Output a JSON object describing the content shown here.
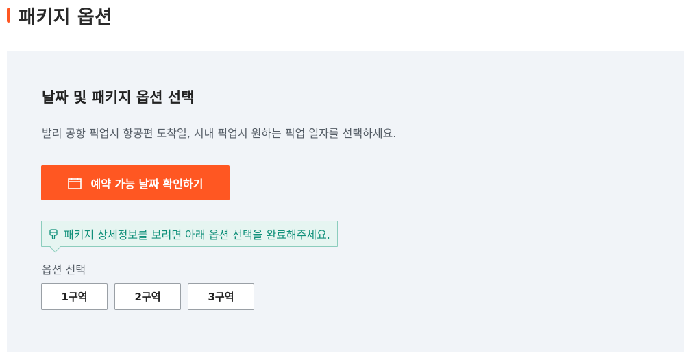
{
  "section": {
    "title": "패키지 옵션",
    "accent_color": "#ff5722"
  },
  "panel": {
    "title": "날짜 및 패키지 옵션 선택",
    "description": "발리 공항 픽업시 항공편 도착일, 시내 픽업시 원하는 픽업 일자를 선택하세요.",
    "date_button": {
      "label": "예약 가능 날짜 확인하기",
      "icon": "calendar-icon",
      "color": "#ff5722"
    },
    "notice": {
      "text": "패키지 상세정보를 보려면 아래 옵션 선택을 완료해주세요.",
      "icon": "hand-pointing-down-icon",
      "color": "#10907a"
    },
    "options": {
      "label": "옵션 선택",
      "items": [
        "1구역",
        "2구역",
        "3구역"
      ]
    }
  }
}
